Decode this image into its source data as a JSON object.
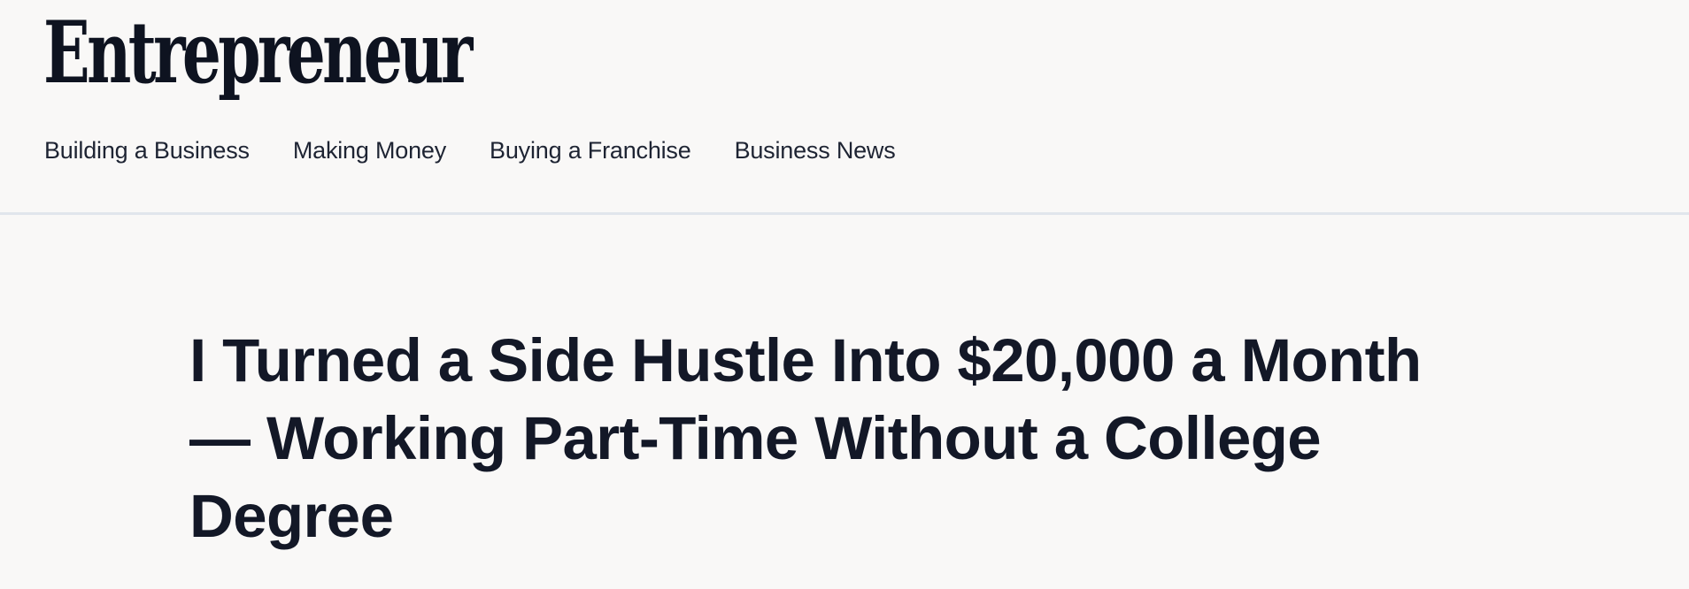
{
  "header": {
    "logo_text": "Entrepreneur",
    "nav": [
      {
        "label": "Building a Business"
      },
      {
        "label": "Making Money"
      },
      {
        "label": "Buying a Franchise"
      },
      {
        "label": "Business News"
      }
    ]
  },
  "article": {
    "headline_lines": [
      "I Turned a Side Hustle Into $20,000 a Month",
      "— Working Part-Time Without a College",
      "Degree"
    ]
  },
  "colors": {
    "background": "#f9f8f7",
    "text": "#141927",
    "divider": "#e1e6ec"
  }
}
